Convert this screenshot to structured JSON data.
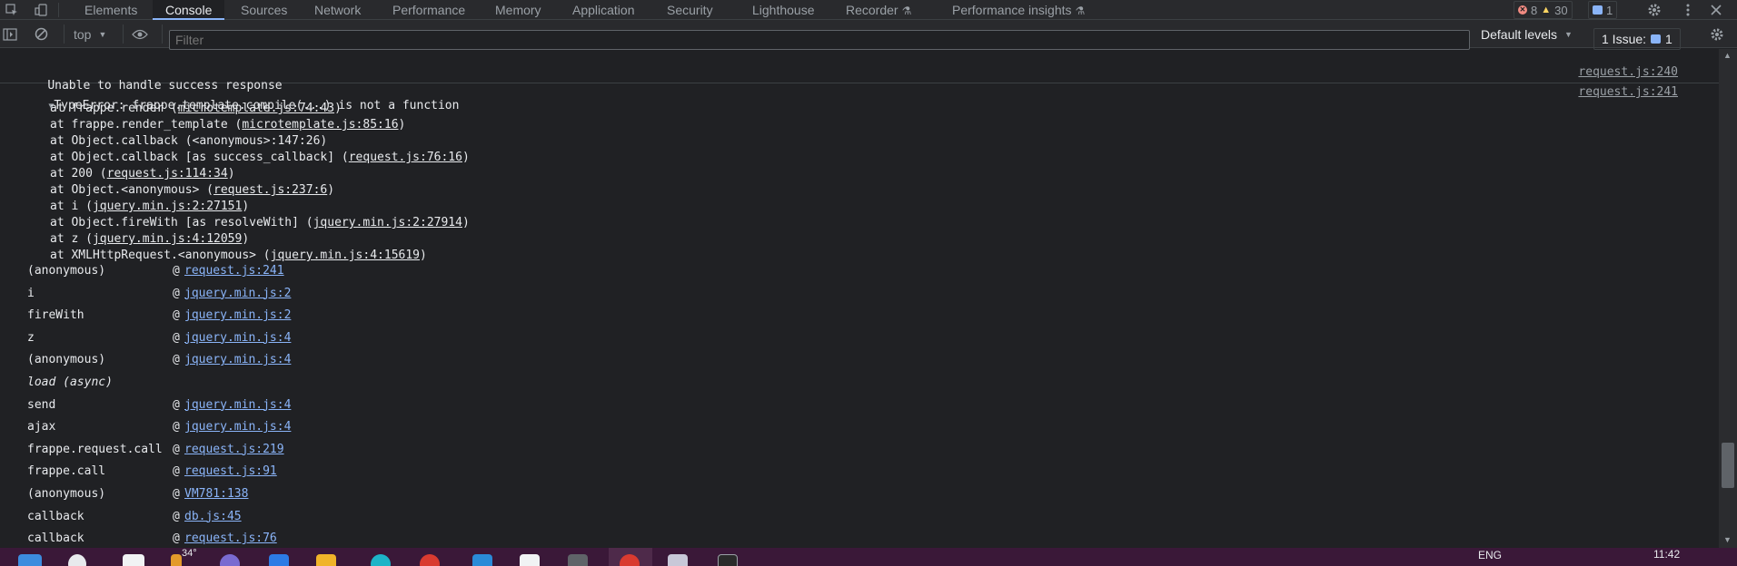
{
  "toolbar_tabs": {
    "elements": "Elements",
    "console": "Console",
    "sources": "Sources",
    "network": "Network",
    "performance": "Performance",
    "memory": "Memory",
    "application": "Application",
    "security": "Security",
    "lighthouse": "Lighthouse",
    "recorder": "Recorder",
    "performance_insights": "Performance insights"
  },
  "counts": {
    "errors": "8",
    "warnings": "30",
    "issues": "1"
  },
  "console_toolbar": {
    "context": "top",
    "filter_placeholder": "Filter",
    "levels": "Default levels",
    "issues_label": "1 Issue:",
    "issues_count": "1"
  },
  "messages": {
    "first": {
      "text": "Unable to handle success response",
      "source": "request.js:240"
    },
    "error": {
      "text": "TypeError: frappe.template.compile(...) is not a function",
      "source": "request.js:241"
    }
  },
  "trace": [
    {
      "pre": "at frappe.render (",
      "link": "microtemplate.js:74:43",
      "post": ")"
    },
    {
      "pre": "at frappe.render_template (",
      "link": "microtemplate.js:85:16",
      "post": ")"
    },
    {
      "pre": "at Object.callback (<anonymous>:147:26)",
      "link": "",
      "post": ""
    },
    {
      "pre": "at Object.callback [as success_callback] (",
      "link": "request.js:76:16",
      "post": ")"
    },
    {
      "pre": "at 200 (",
      "link": "request.js:114:34",
      "post": ")"
    },
    {
      "pre": "at Object.<anonymous> (",
      "link": "request.js:237:6",
      "post": ")"
    },
    {
      "pre": "at i (",
      "link": "jquery.min.js:2:27151",
      "post": ")"
    },
    {
      "pre": "at Object.fireWith [as resolveWith] (",
      "link": "jquery.min.js:2:27914",
      "post": ")"
    },
    {
      "pre": "at z (",
      "link": "jquery.min.js:4:12059",
      "post": ")"
    },
    {
      "pre": "at XMLHttpRequest.<anonymous> (",
      "link": "jquery.min.js:4:15619",
      "post": ")"
    }
  ],
  "stack": [
    {
      "fn": "(anonymous)",
      "link": "request.js:241"
    },
    {
      "fn": "i",
      "link": "jquery.min.js:2"
    },
    {
      "fn": "fireWith",
      "link": "jquery.min.js:2"
    },
    {
      "fn": "z",
      "link": "jquery.min.js:4"
    },
    {
      "fn": "(anonymous)",
      "link": "jquery.min.js:4"
    },
    {
      "async": "load (async)"
    },
    {
      "fn": "send",
      "link": "jquery.min.js:4"
    },
    {
      "fn": "ajax",
      "link": "jquery.min.js:4"
    },
    {
      "fn": "frappe.request.call",
      "link": "request.js:219"
    },
    {
      "fn": "frappe.call",
      "link": "request.js:91"
    },
    {
      "fn": "(anonymous)",
      "link": "VM781:138"
    },
    {
      "fn": "callback",
      "link": "db.js:45"
    },
    {
      "fn": "callback",
      "link": "request.js:76"
    }
  ],
  "stack_at_symbol": "@",
  "taskbar": {
    "weather": "34°",
    "lang": "ENG",
    "time": "11:42"
  },
  "colors": {
    "link": "#8ab4f8",
    "error": "#f28b82",
    "warning": "#fdd663",
    "background": "#202124"
  }
}
